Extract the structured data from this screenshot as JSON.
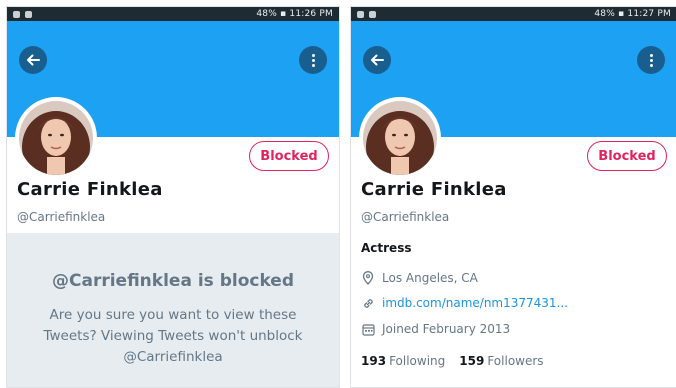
{
  "left": {
    "status": {
      "right": "48% ▪ 11:26 PM"
    },
    "profile": {
      "name": "Carrie Finklea",
      "handle": "@Carriefinklea"
    },
    "blocked_button": "Blocked",
    "blocked_notice": {
      "title": "@Carriefinklea is blocked",
      "text": "Are you sure you want to view these Tweets? Viewing Tweets won't unblock @Carriefinklea"
    }
  },
  "right": {
    "status": {
      "right": "48% ▪ 11:27 PM"
    },
    "profile": {
      "name": "Carrie Finklea",
      "handle": "@Carriefinklea",
      "bio": "Actress",
      "location": "Los Angeles, CA",
      "website": "imdb.com/name/nm1377431...",
      "joined": "Joined February 2013",
      "following_count": "193",
      "following_label": "Following",
      "followers_count": "159",
      "followers_label": "Followers"
    },
    "blocked_button": "Blocked"
  },
  "colors": {
    "banner": "#1da1f2",
    "blocked": "#e0245e",
    "muted": "#657786",
    "link": "#1b95e0",
    "notice_bg": "#e6ecf0"
  }
}
